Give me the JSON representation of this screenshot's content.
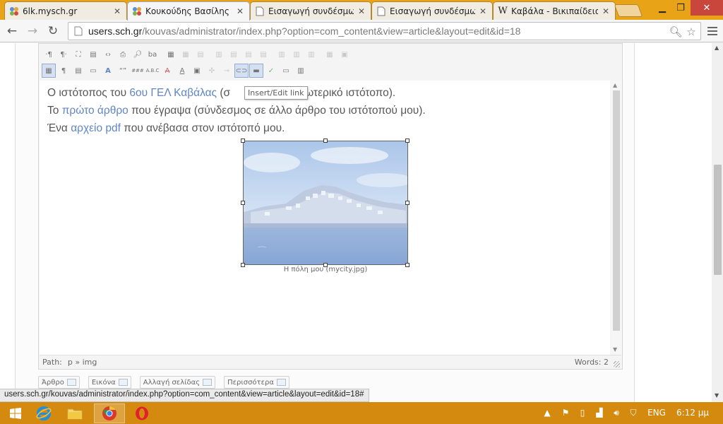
{
  "browser": {
    "tabs": [
      {
        "title": "6lk.mysch.gr",
        "icon": "joomla-icon",
        "active": false
      },
      {
        "title": "Κουκούδης Βασίλης -",
        "icon": "joomla-icon",
        "active": true
      },
      {
        "title": "Εισαγωγή συνδέσμω",
        "icon": "page-icon",
        "active": false
      },
      {
        "title": "Εισαγωγή συνδέσμω",
        "icon": "page-icon",
        "active": false
      },
      {
        "title": "Καβάλα - Βικιπαίδεια",
        "icon": "wikipedia-icon",
        "active": false
      }
    ],
    "url_host": "users.sch.gr",
    "url_path": "/kouvas/administrator/index.php?option=com_content&view=article&layout=edit&id=18",
    "status_url": "users.sch.gr/kouvas/administrator/index.php?option=com_content&view=article&layout=edit&id=18#"
  },
  "editor": {
    "line1": {
      "pre": "Ο ιστότοπος του ",
      "link": "6ου ΓΕΛ Καβάλας",
      "post": " (σ",
      "post2": "ε εξωτερικό ιστότοπο)."
    },
    "line2": {
      "pre": "Το ",
      "link": "πρώτο άρθρο",
      "post": " που έγραψα (σύνδεσμος σε άλλο άρθρο του ιστότοπού μου)."
    },
    "line3": {
      "pre": "Ένα ",
      "link": "αρχείο pdf",
      "post": " που ανέβασα στον ιστότοπό μου."
    },
    "tooltip": "Insert/Edit link",
    "image_caption": "Η πόλη μου (mycity.jpg)",
    "path_label": "Path:",
    "path_value": "p » img",
    "words_label": "Words: 2",
    "buttons": [
      "Άρθρο",
      "Εικόνα",
      "Αλλαγή σελίδας",
      "Περισσότερα"
    ]
  },
  "taskbar": {
    "lang": "ENG",
    "time": "6:12 μμ"
  },
  "colors": {
    "taskbar": "#d48a0f",
    "tabstrip": "#e8a317",
    "link": "#2a5db0"
  }
}
